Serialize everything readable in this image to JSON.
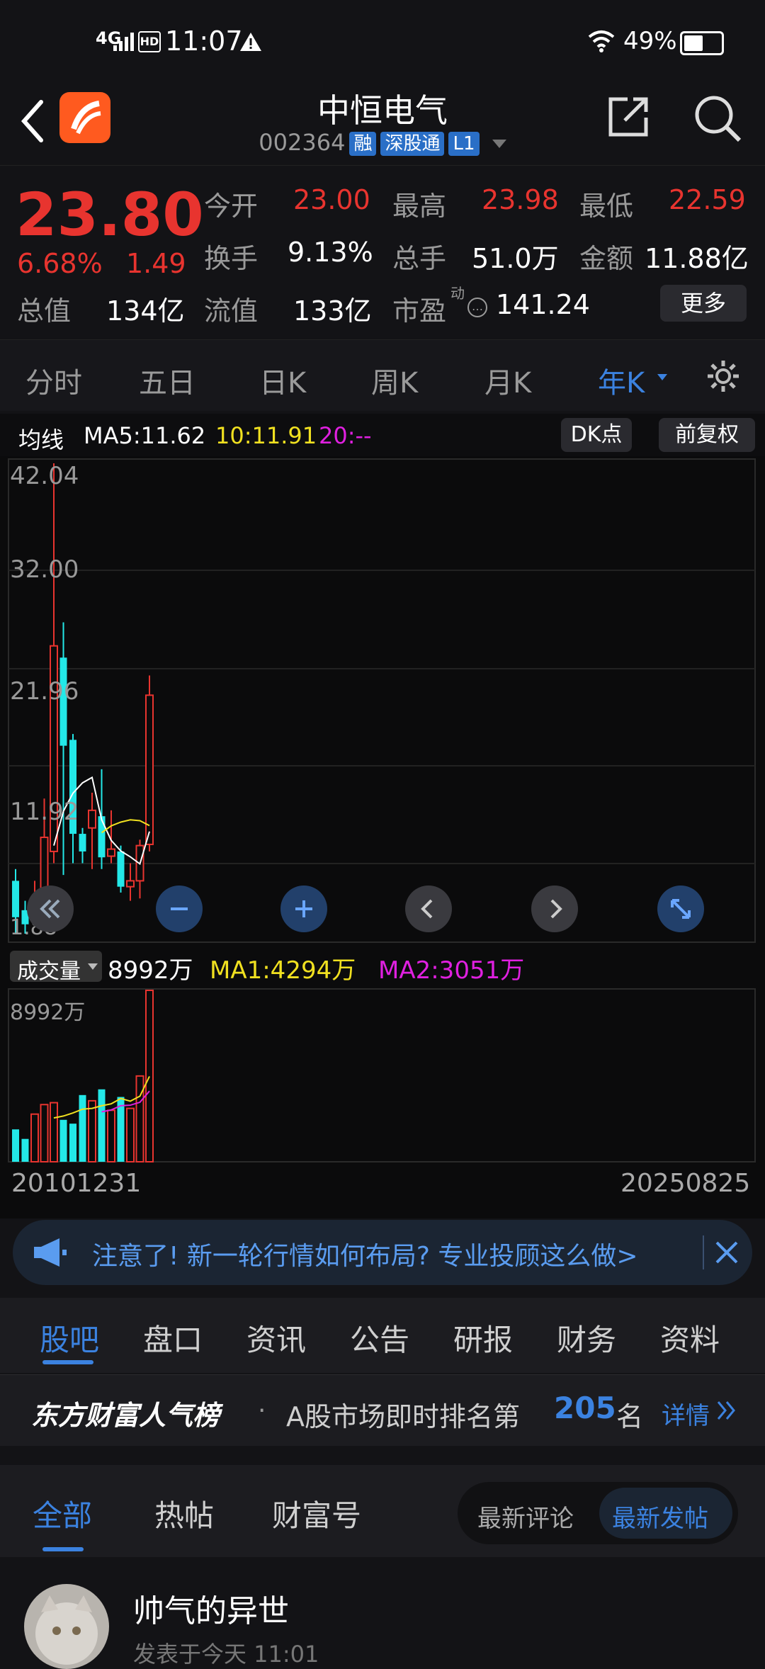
{
  "status_bar": {
    "network": "4G",
    "time": "11:07",
    "battery": "49%"
  },
  "header": {
    "name": "中恒电气",
    "code": "002364",
    "tags": [
      "融",
      "深股通",
      "L1"
    ]
  },
  "quote": {
    "price": "23.80",
    "change_pct": "6.68%",
    "change": "1.49",
    "rows": [
      [
        {
          "label": "今开",
          "value": "23.00",
          "red": true
        },
        {
          "label": "最高",
          "value": "23.98",
          "red": true
        },
        {
          "label": "最低",
          "value": "22.59",
          "red": true
        }
      ],
      [
        {
          "label": "换手",
          "value": "9.13%",
          "red": false
        },
        {
          "label": "总手",
          "value": "51.0万",
          "red": false
        },
        {
          "label": "金额",
          "value": "11.88亿",
          "red": false
        }
      ],
      [
        {
          "label": "总值",
          "value": "134亿",
          "red": false
        },
        {
          "label": "流值",
          "value": "133亿",
          "red": false
        },
        {
          "label": "市盈",
          "value": "141.24",
          "red": false
        }
      ]
    ],
    "pe_superscript": "动",
    "more_label": "更多"
  },
  "chart_tabs": [
    "分时",
    "五日",
    "日K",
    "周K",
    "月K",
    "年K"
  ],
  "active_chart_tab": "年K",
  "ma": {
    "label": "均线",
    "ma5": "MA5:11.62",
    "ma10": "10:11.91",
    "ma20": "20:--",
    "dk_label": "DK点",
    "adj_label": "前复权"
  },
  "y_labels": [
    "42.04",
    "32.00",
    "21.96",
    "11.92",
    "1.88"
  ],
  "volume": {
    "label": "成交量",
    "value": "8992万",
    "ma1": "MA1:4294万",
    "ma2": "MA2:3051万",
    "max_label": "8992万"
  },
  "dates": {
    "start": "20101231",
    "end": "20250825"
  },
  "banner": {
    "text": "注意了! 新一轮行情如何布局? 专业投顾这么做>"
  },
  "bottom_tabs": [
    "股吧",
    "盘口",
    "资讯",
    "公告",
    "研报",
    "财务",
    "资料"
  ],
  "rank": {
    "brand": "东方财富人气榜",
    "text": "A股市场即时排名第",
    "number": "205",
    "unit": "名",
    "link": "详情"
  },
  "feed_tabs": [
    "全部",
    "热帖",
    "财富号"
  ],
  "sort_options": [
    "最新评论",
    "最新发帖"
  ],
  "post": {
    "author": "帅气的异世",
    "meta": "发表于今天 11:01"
  },
  "chart_data": {
    "type": "candlestick",
    "x_range": [
      "20101231",
      "20250825"
    ],
    "ylim": [
      1.88,
      42.04
    ],
    "candles": [
      {
        "open": 6.5,
        "close": 3.4,
        "high": 7.5,
        "low": 2.0
      },
      {
        "open": 4.0,
        "close": 2.8,
        "high": 4.8,
        "low": 2.0
      },
      {
        "open": 3.5,
        "close": 4.6,
        "high": 6.5,
        "low": 3.0
      },
      {
        "open": 4.8,
        "close": 10.2,
        "high": 13.5,
        "low": 4.0
      },
      {
        "open": 9.0,
        "close": 26.5,
        "high": 42.04,
        "low": 8.0
      },
      {
        "open": 25.5,
        "close": 18.0,
        "high": 28.5,
        "low": 7.0
      },
      {
        "open": 18.5,
        "close": 10.5,
        "high": 19.0,
        "low": 8.0
      },
      {
        "open": 10.5,
        "close": 9.0,
        "high": 11.0,
        "low": 8.0
      },
      {
        "open": 11.0,
        "close": 12.5,
        "high": 14.0,
        "low": 7.5
      },
      {
        "open": 12.0,
        "close": 8.5,
        "high": 16.0,
        "low": 7.5
      },
      {
        "open": 8.6,
        "close": 9.2,
        "high": 12.5,
        "low": 8.0
      },
      {
        "open": 9.0,
        "close": 6.0,
        "high": 9.5,
        "low": 5.5
      },
      {
        "open": 6.0,
        "close": 6.5,
        "high": 8.0,
        "low": 4.8
      },
      {
        "open": 6.5,
        "close": 9.5,
        "high": 10.0,
        "low": 5.0
      },
      {
        "open": 9.6,
        "close": 22.3,
        "high": 23.98,
        "low": 9.0
      }
    ],
    "volume_max": 8992,
    "volumes": [
      1700,
      1200,
      2500,
      3000,
      3100,
      2200,
      2000,
      3500,
      3200,
      3800,
      2700,
      3400,
      2800,
      4500,
      8992
    ]
  }
}
